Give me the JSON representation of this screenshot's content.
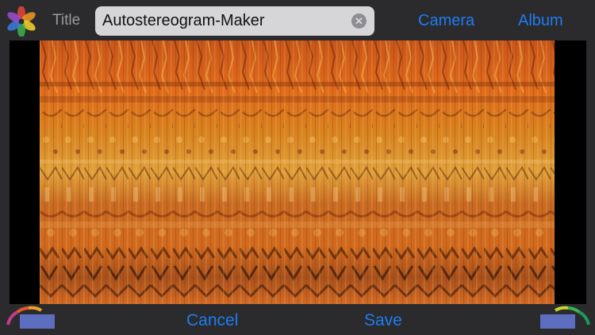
{
  "topbar": {
    "app_icon": "flower-icon",
    "title_label": "Title",
    "title_value": "Autostereogram-Maker",
    "clear_icon": "clear-circle-icon",
    "camera_label": "Camera",
    "album_label": "Album"
  },
  "bottombar": {
    "cancel_label": "Cancel",
    "save_label": "Save"
  },
  "colors": {
    "accent": "#1e7cf2",
    "background": "#2b2b2d",
    "swatch": "#5d6dbf"
  }
}
